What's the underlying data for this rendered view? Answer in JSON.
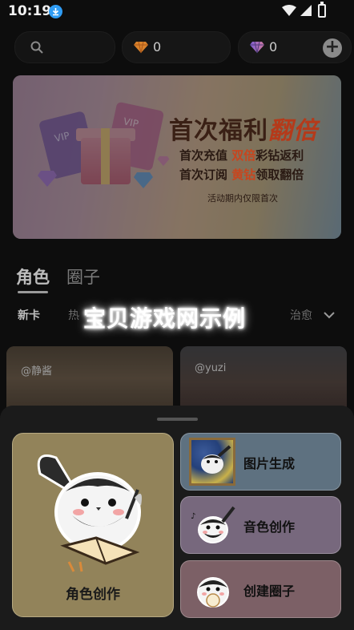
{
  "status_bar": {
    "time": "10:19"
  },
  "currency": {
    "gold_count": "0",
    "diamond_count": "0",
    "plus_label": "+"
  },
  "banner": {
    "title_prefix": "首次福利",
    "title_highlight": "翻倍",
    "line1_prefix": "首次充值 ",
    "line1_highlight": "双倍",
    "line1_suffix": "彩钻返利",
    "line2_prefix": "首次订阅 ",
    "line2_highlight": "黄钻",
    "line2_suffix": "领取翻倍",
    "note": "活动期内仅限首次",
    "vip_card1": "VIP",
    "vip_card2": "VIP"
  },
  "tabs": [
    {
      "label": "角色"
    },
    {
      "label": "圈子"
    }
  ],
  "filters": {
    "new": "新卡",
    "hot": "热",
    "healing": "治愈"
  },
  "watermark": "宝贝游戏网示例",
  "characters": [
    {
      "name": "@静酱"
    },
    {
      "name": "@yuzi"
    }
  ],
  "actions": {
    "role_create": "角色创作",
    "image_gen": "图片生成",
    "voice_create": "音色创作",
    "circle_create": "创建圈子"
  },
  "colors": {
    "background": "#0d0d0d",
    "sheet": "#1b1b1b",
    "role_card": "#92835a",
    "image_card": "#5e7180",
    "voice_card": "#77687d",
    "circle_card": "#7c6066"
  }
}
